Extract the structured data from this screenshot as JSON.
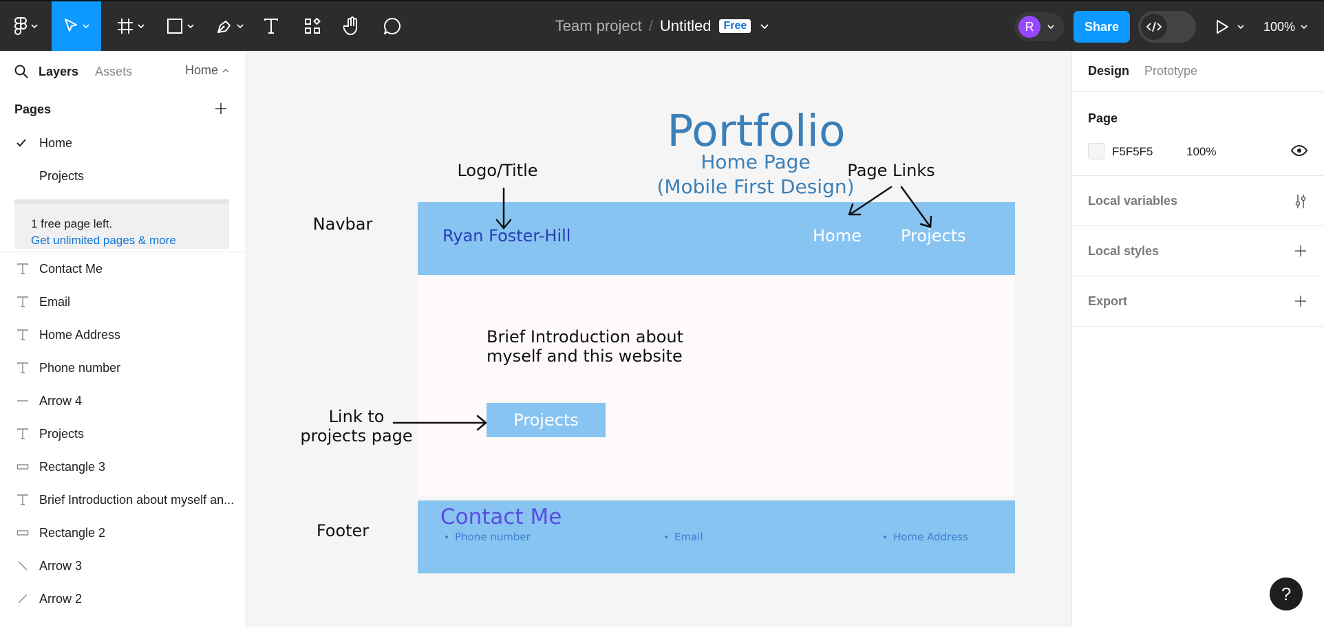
{
  "toolbar": {
    "team": "Team project",
    "separator": "/",
    "file_name": "Untitled",
    "plan_badge": "Free",
    "avatar_initial": "R",
    "share_label": "Share",
    "zoom_level": "100%",
    "icons": [
      "figma-menu-icon",
      "move-tool-icon",
      "frame-tool-icon",
      "shape-tool-icon",
      "pen-tool-icon",
      "text-tool-icon",
      "resources-icon",
      "hand-tool-icon",
      "comment-icon",
      "dev-mode-icon",
      "present-icon"
    ],
    "accent_color": "#0d99ff"
  },
  "left_panel": {
    "tabs": {
      "layers": "Layers",
      "assets": "Assets"
    },
    "current_page": "Home",
    "pages_header": "Pages",
    "pages": [
      {
        "label": "Home",
        "selected": true
      },
      {
        "label": "Projects",
        "selected": false
      }
    ],
    "upgrade": {
      "message": "1 free page left.",
      "link": "Get unlimited pages & more",
      "progress": 0.66
    },
    "layers": [
      {
        "label": "Contact Me",
        "icon": "text-layer-icon"
      },
      {
        "label": "Email",
        "icon": "text-layer-icon"
      },
      {
        "label": "Home Address",
        "icon": "text-layer-icon"
      },
      {
        "label": "Phone number",
        "icon": "text-layer-icon"
      },
      {
        "label": "Arrow 4",
        "icon": "line-layer-icon"
      },
      {
        "label": "Projects",
        "icon": "text-layer-icon"
      },
      {
        "label": "Rectangle 3",
        "icon": "rectangle-layer-icon"
      },
      {
        "label": "Brief Introduction about myself an...",
        "icon": "text-layer-icon"
      },
      {
        "label": "Rectangle 2",
        "icon": "rectangle-layer-icon"
      },
      {
        "label": "Arrow 3",
        "icon": "arrow-layer-icon"
      },
      {
        "label": "Arrow 2",
        "icon": "arrow-layer-icon"
      }
    ]
  },
  "canvas": {
    "title": "Portfolio",
    "subtitle_line1": "Home Page",
    "subtitle_line2": "(Mobile First Design)",
    "annotations": {
      "logo": "Logo/Title",
      "page_links": "Page Links",
      "navbar": "Navbar",
      "link_line1": "Link to",
      "link_line2": "projects page",
      "footer": "Footer"
    },
    "navbar": {
      "name": "Ryan Foster-Hill",
      "home": "Home",
      "projects": "Projects"
    },
    "intro_line1": "Brief Introduction about",
    "intro_line2": "myself and this website",
    "projects_button": "Projects",
    "footer": {
      "title": "Contact Me",
      "items": [
        "Phone number",
        "Email",
        "Home Address"
      ]
    },
    "colors": {
      "navbar": "#87c4f1",
      "title": "#3a7fb8",
      "contact": "#5b4ce0"
    }
  },
  "right_panel": {
    "tabs": {
      "design": "Design",
      "prototype": "Prototype"
    },
    "page_section": "Page",
    "background_hex": "F5F5F5",
    "background_opacity": "100%",
    "sections": [
      "Local variables",
      "Local styles",
      "Export"
    ]
  },
  "help_label": "?"
}
